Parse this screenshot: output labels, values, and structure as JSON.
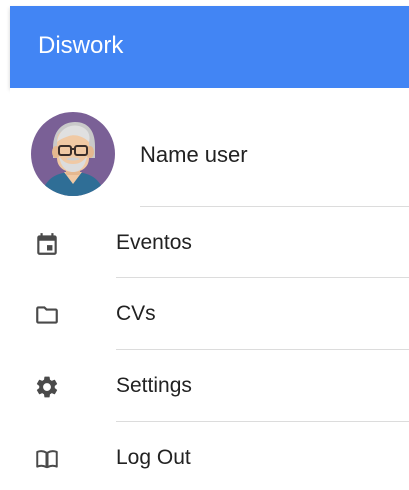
{
  "app_bar": {
    "title": "Diswork",
    "background_color": "#4285F4",
    "title_color": "#FFFFFF"
  },
  "profile": {
    "name": "Name user",
    "avatar": "avatar-old-man-with-glasses-icon"
  },
  "nav": {
    "items": [
      {
        "label": "Eventos",
        "icon": "calendar-icon"
      },
      {
        "label": "CVs",
        "icon": "folder-icon"
      },
      {
        "label": "Settings",
        "icon": "gear-icon"
      },
      {
        "label": "Log Out",
        "icon": "book-icon"
      }
    ]
  }
}
